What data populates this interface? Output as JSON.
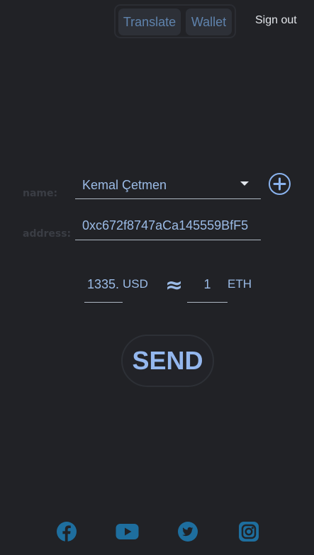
{
  "nav": {
    "translate_label": "Translate",
    "wallet_label": "Wallet",
    "signout_label": "Sign out"
  },
  "form": {
    "name_label": "name:",
    "name_value": "Kemal Çetmen",
    "address_label": "address:",
    "address_value": "0xc672f8747aCa145559BfF5",
    "usd_value": "1335.",
    "usd_unit": "USD",
    "approx_symbol": "≈",
    "eth_value": "1",
    "eth_unit": "ETH",
    "send_label": "SEND"
  },
  "footer": {
    "icons": [
      "facebook-icon",
      "youtube-icon",
      "twitter-icon",
      "instagram-icon"
    ]
  },
  "colors": {
    "background": "#212226",
    "accent": "#9bbbe6",
    "social": "#1e6e9e"
  }
}
